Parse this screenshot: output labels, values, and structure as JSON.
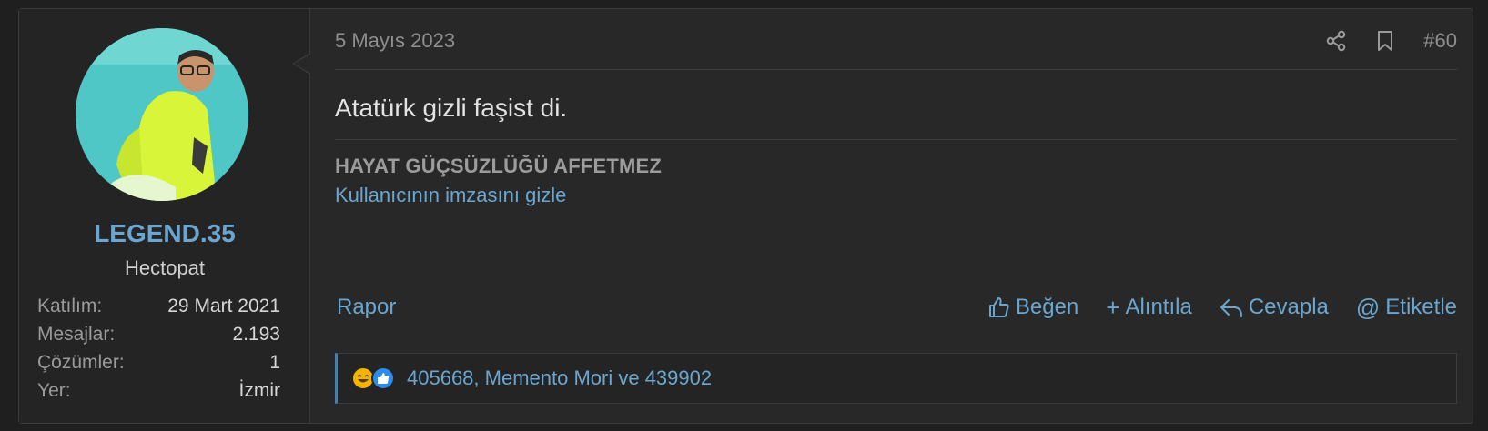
{
  "user": {
    "name": "LEGEND.35",
    "title": "Hectopat",
    "stats": [
      {
        "label": "Katılım:",
        "value": "29 Mart 2021"
      },
      {
        "label": "Mesajlar:",
        "value": "2.193"
      },
      {
        "label": "Çözümler:",
        "value": "1"
      },
      {
        "label": "Yer:",
        "value": "İzmir"
      }
    ]
  },
  "post": {
    "date": "5 Mayıs 2023",
    "number": "#60",
    "message": "Atatürk gizli faşist di.",
    "signature": "HAYAT GÜÇSÜZLÜĞÜ AFFETMEZ",
    "hide_signature": "Kullanıcının imzasını gizle"
  },
  "actions": {
    "report": "Rapor",
    "like": "Beğen",
    "quote": "Alıntıla",
    "reply": "Cevapla",
    "tag": "Etiketle"
  },
  "reactions": {
    "text": "405668, Memento Mori ve 439902",
    "icons": [
      "laugh-reaction-icon",
      "like-reaction-icon"
    ]
  },
  "icons": {
    "share": "share-icon",
    "bookmark": "bookmark-icon"
  },
  "colors": {
    "link": "#6aa6cf",
    "background": "#282828"
  }
}
